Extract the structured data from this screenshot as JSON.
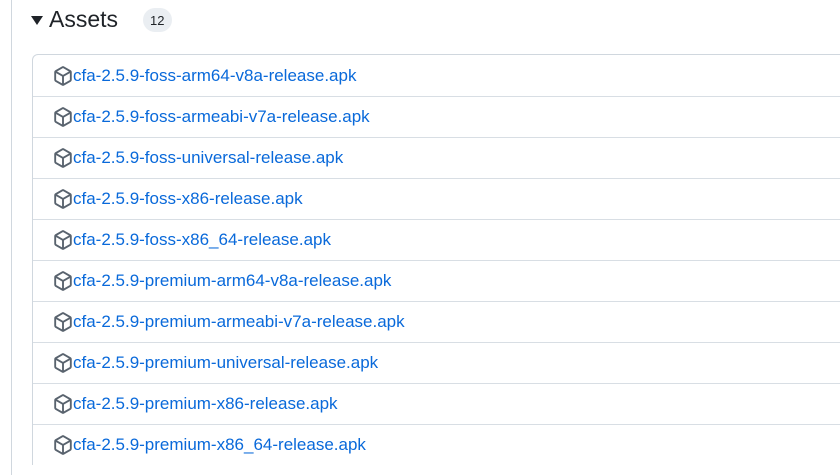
{
  "assets": {
    "title": "Assets",
    "count": "12",
    "items": [
      {
        "name": "cfa-2.5.9-foss-arm64-v8a-release.apk"
      },
      {
        "name": "cfa-2.5.9-foss-armeabi-v7a-release.apk"
      },
      {
        "name": "cfa-2.5.9-foss-universal-release.apk"
      },
      {
        "name": "cfa-2.5.9-foss-x86-release.apk"
      },
      {
        "name": "cfa-2.5.9-foss-x86_64-release.apk"
      },
      {
        "name": "cfa-2.5.9-premium-arm64-v8a-release.apk"
      },
      {
        "name": "cfa-2.5.9-premium-armeabi-v7a-release.apk"
      },
      {
        "name": "cfa-2.5.9-premium-universal-release.apk"
      },
      {
        "name": "cfa-2.5.9-premium-x86-release.apk"
      },
      {
        "name": "cfa-2.5.9-premium-x86_64-release.apk"
      }
    ],
    "icon": "package-icon"
  },
  "colors": {
    "link": "#0969da",
    "text": "#1f2328",
    "border": "#d0d7de",
    "badge_bg": "#eaeef2",
    "icon": "#59636e"
  }
}
